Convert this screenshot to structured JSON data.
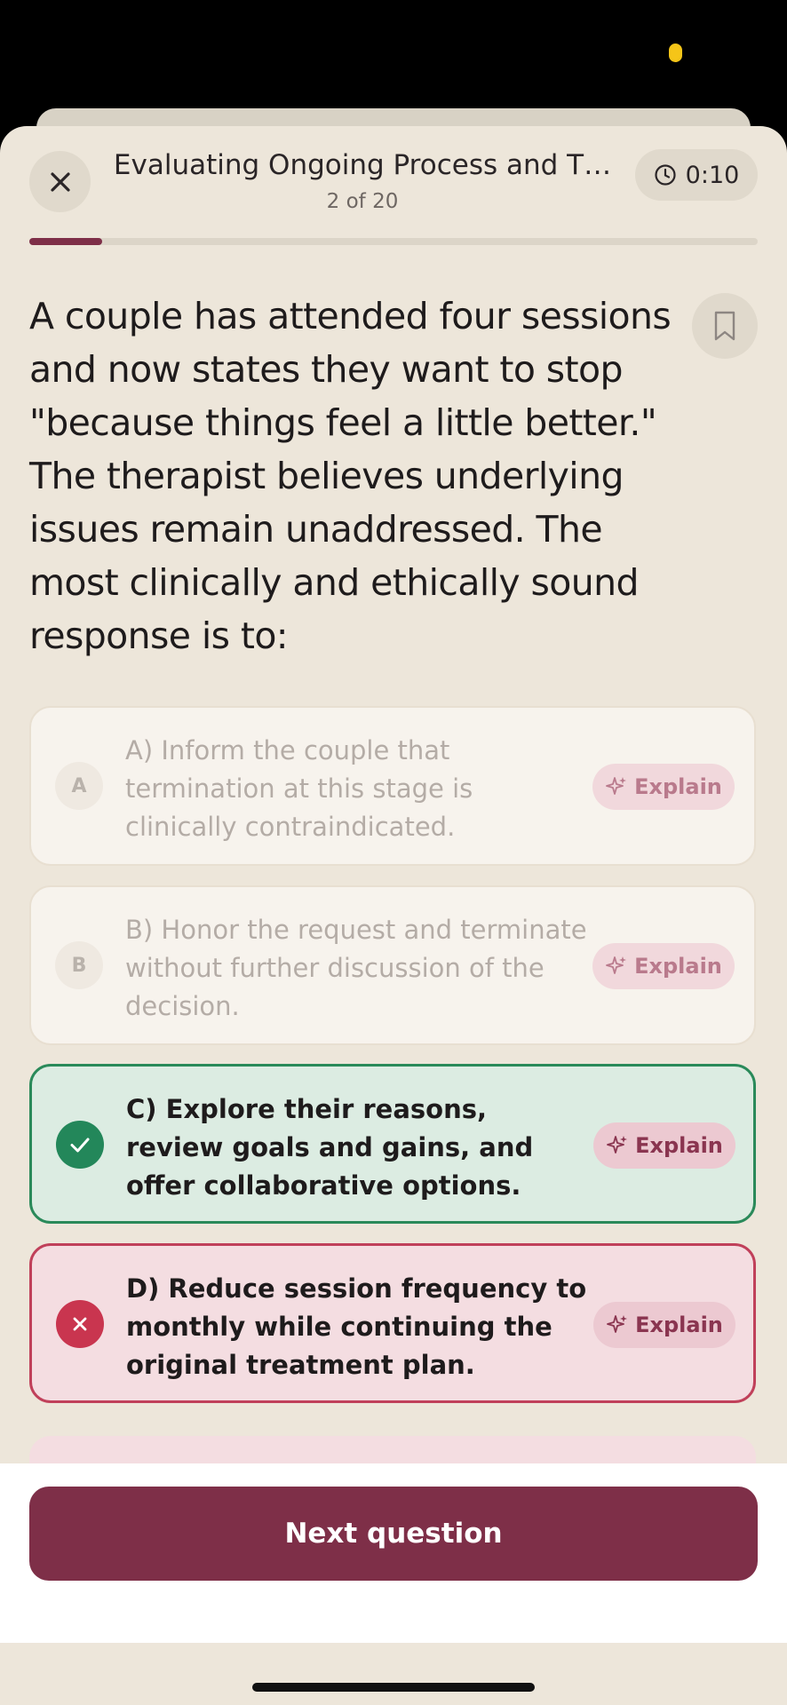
{
  "colors": {
    "accent": "#7e2f48",
    "correct": "#23875a",
    "incorrect": "#c9354f",
    "background": "#ede6da"
  },
  "header": {
    "title": "Evaluating Ongoing Process and T…",
    "position_label": "2 of 20",
    "timer": "0:10",
    "progress_fraction": 0.1,
    "close_icon": "close-icon",
    "timer_icon": "clock-icon"
  },
  "question": {
    "text": "A couple has attended four sessions and now states they want to stop \"because things feel a little better.\" The therapist believes underlying issues remain unaddressed. The most clinically and ethically sound response is to:",
    "bookmark_icon": "bookmark-icon"
  },
  "options": [
    {
      "letter": "A",
      "text": "A) Inform the couple that termination at this stage is clinically contraindicated.",
      "state": "unselected",
      "explain_label": "Explain"
    },
    {
      "letter": "B",
      "text": "B) Honor the request and terminate without further discussion of the decision.",
      "state": "unselected",
      "explain_label": "Explain"
    },
    {
      "letter": "C",
      "text": "C) Explore their reasons, review goals and gains, and offer collaborative options.",
      "state": "correct",
      "explain_label": "Explain"
    },
    {
      "letter": "D",
      "text": "D) Reduce session frequency to monthly while continuing the original treatment plan.",
      "state": "incorrect",
      "explain_label": "Explain"
    }
  ],
  "footer": {
    "next_label": "Next question"
  }
}
